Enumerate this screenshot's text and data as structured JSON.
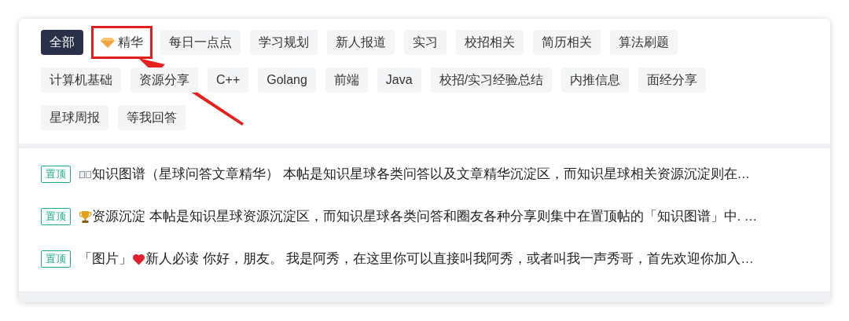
{
  "tags": [
    {
      "label": "全部",
      "selected": true,
      "kind": "plain"
    },
    {
      "label": "精华",
      "selected": false,
      "kind": "featured"
    },
    {
      "label": "每日一点点",
      "selected": false,
      "kind": "plain"
    },
    {
      "label": "学习规划",
      "selected": false,
      "kind": "plain"
    },
    {
      "label": "新人报道",
      "selected": false,
      "kind": "plain"
    },
    {
      "label": "实习",
      "selected": false,
      "kind": "plain"
    },
    {
      "label": "校招相关",
      "selected": false,
      "kind": "plain"
    },
    {
      "label": "简历相关",
      "selected": false,
      "kind": "plain"
    },
    {
      "label": "算法刷题",
      "selected": false,
      "kind": "plain"
    },
    {
      "label": "计算机基础",
      "selected": false,
      "kind": "plain"
    },
    {
      "label": "资源分享",
      "selected": false,
      "kind": "plain"
    },
    {
      "label": "C++",
      "selected": false,
      "kind": "plain"
    },
    {
      "label": "Golang",
      "selected": false,
      "kind": "plain"
    },
    {
      "label": "前端",
      "selected": false,
      "kind": "plain"
    },
    {
      "label": "Java",
      "selected": false,
      "kind": "plain"
    },
    {
      "label": "校招/实习经验总结",
      "selected": false,
      "kind": "plain"
    },
    {
      "label": "内推信息",
      "selected": false,
      "kind": "plain"
    },
    {
      "label": "面经分享",
      "selected": false,
      "kind": "plain"
    },
    {
      "label": "星球周报",
      "selected": false,
      "kind": "plain"
    },
    {
      "label": "等我回答",
      "selected": false,
      "kind": "plain"
    }
  ],
  "pinned_posts": [
    {
      "badge": "置顶",
      "kind": "book",
      "text": "知识图谱（星球问答文章精华） 本帖是知识星球各类问答以及文章精华沉淀区，而知识星球相关资源沉淀则在…"
    },
    {
      "badge": "置顶",
      "kind": "trophy",
      "text": "资源沉淀 本帖是知识星球资源沉淀区，而知识星球各类问答和圈友各种分享则集中在置顶帖的「知识图谱」中. …"
    },
    {
      "badge": "置顶",
      "prefix": "「图片」",
      "kind": "heart",
      "text": "新人必读 你好，朋友。 我是阿秀，在这里你可以直接叫我阿秀，或者叫我一声秀哥，首先欢迎你加入…"
    }
  ]
}
